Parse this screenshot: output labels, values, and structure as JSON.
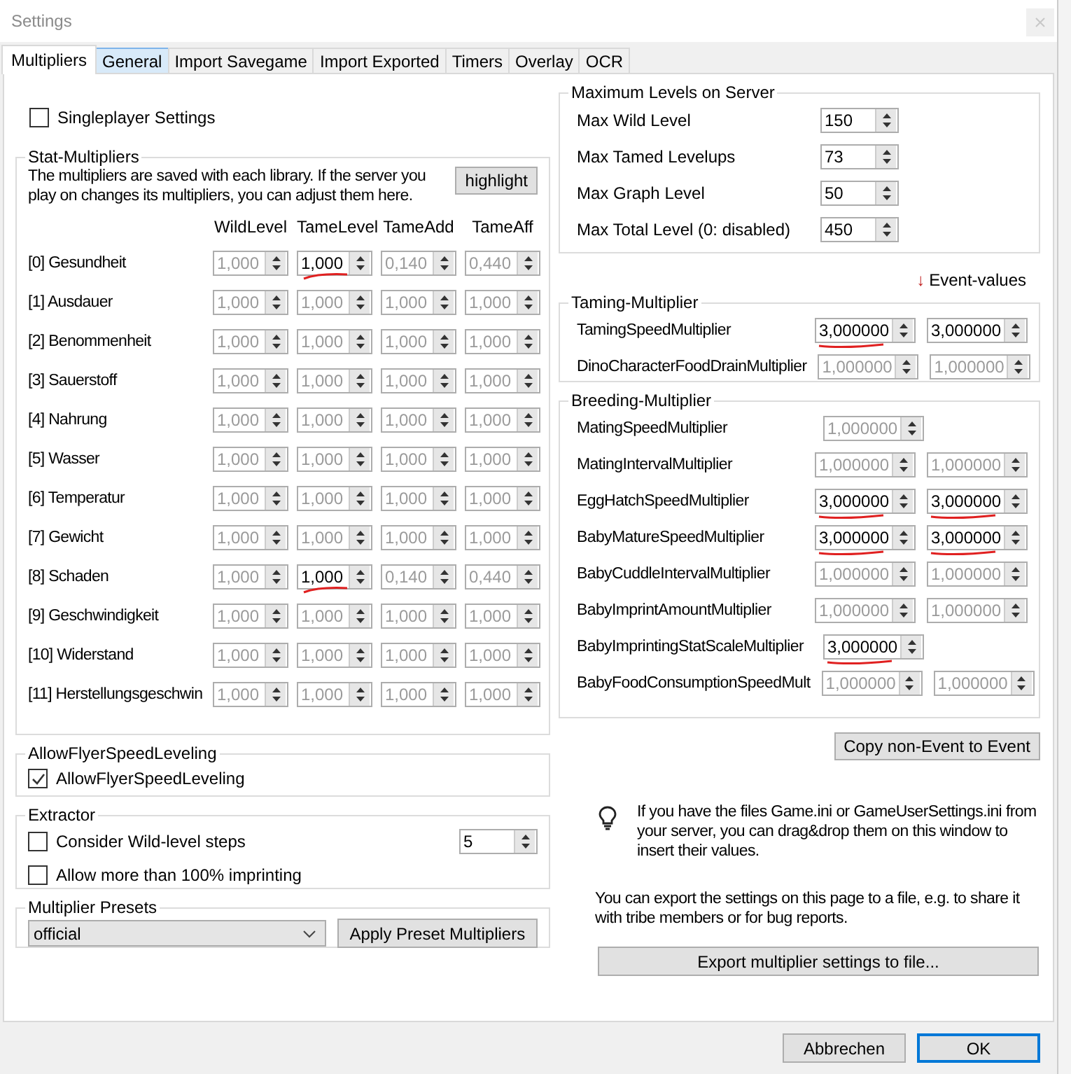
{
  "window": {
    "title": "Settings"
  },
  "tabs": [
    {
      "label": "Multipliers",
      "selected": true,
      "hovered": false
    },
    {
      "label": "General",
      "selected": false,
      "hovered": true
    },
    {
      "label": "Import Savegame",
      "selected": false,
      "hovered": false
    },
    {
      "label": "Import Exported",
      "selected": false,
      "hovered": false
    },
    {
      "label": "Timers",
      "selected": false,
      "hovered": false
    },
    {
      "label": "Overlay",
      "selected": false,
      "hovered": false
    },
    {
      "label": "OCR",
      "selected": false,
      "hovered": false
    }
  ],
  "singleplayer": {
    "label": "Singleplayer Settings",
    "checked": false
  },
  "stat_multipliers": {
    "title": "Stat-Multipliers",
    "note": "The multipliers are saved with each library. If the server you play on changes its multipliers, you can adjust them here.",
    "highlight_button": "highlight",
    "columns": [
      "WildLevel",
      "TameLevel",
      "TameAdd",
      "TameAff"
    ],
    "rows": [
      {
        "label": "[0] Gesundheit",
        "values": [
          {
            "value": "1,000",
            "enabled": false,
            "marked": false
          },
          {
            "value": "1,000",
            "enabled": true,
            "marked": true
          },
          {
            "value": "0,140",
            "enabled": false,
            "marked": false
          },
          {
            "value": "0,440",
            "enabled": false,
            "marked": false
          }
        ]
      },
      {
        "label": "[1] Ausdauer",
        "values": [
          {
            "value": "1,000",
            "enabled": false,
            "marked": false
          },
          {
            "value": "1,000",
            "enabled": false,
            "marked": false
          },
          {
            "value": "1,000",
            "enabled": false,
            "marked": false
          },
          {
            "value": "1,000",
            "enabled": false,
            "marked": false
          }
        ]
      },
      {
        "label": "[2] Benommenheit",
        "values": [
          {
            "value": "1,000",
            "enabled": false,
            "marked": false
          },
          {
            "value": "1,000",
            "enabled": false,
            "marked": false
          },
          {
            "value": "1,000",
            "enabled": false,
            "marked": false
          },
          {
            "value": "1,000",
            "enabled": false,
            "marked": false
          }
        ]
      },
      {
        "label": "[3] Sauerstoff",
        "values": [
          {
            "value": "1,000",
            "enabled": false,
            "marked": false
          },
          {
            "value": "1,000",
            "enabled": false,
            "marked": false
          },
          {
            "value": "1,000",
            "enabled": false,
            "marked": false
          },
          {
            "value": "1,000",
            "enabled": false,
            "marked": false
          }
        ]
      },
      {
        "label": "[4] Nahrung",
        "values": [
          {
            "value": "1,000",
            "enabled": false,
            "marked": false
          },
          {
            "value": "1,000",
            "enabled": false,
            "marked": false
          },
          {
            "value": "1,000",
            "enabled": false,
            "marked": false
          },
          {
            "value": "1,000",
            "enabled": false,
            "marked": false
          }
        ]
      },
      {
        "label": "[5] Wasser",
        "values": [
          {
            "value": "1,000",
            "enabled": false,
            "marked": false
          },
          {
            "value": "1,000",
            "enabled": false,
            "marked": false
          },
          {
            "value": "1,000",
            "enabled": false,
            "marked": false
          },
          {
            "value": "1,000",
            "enabled": false,
            "marked": false
          }
        ]
      },
      {
        "label": "[6] Temperatur",
        "values": [
          {
            "value": "1,000",
            "enabled": false,
            "marked": false
          },
          {
            "value": "1,000",
            "enabled": false,
            "marked": false
          },
          {
            "value": "1,000",
            "enabled": false,
            "marked": false
          },
          {
            "value": "1,000",
            "enabled": false,
            "marked": false
          }
        ]
      },
      {
        "label": "[7] Gewicht",
        "values": [
          {
            "value": "1,000",
            "enabled": false,
            "marked": false
          },
          {
            "value": "1,000",
            "enabled": false,
            "marked": false
          },
          {
            "value": "1,000",
            "enabled": false,
            "marked": false
          },
          {
            "value": "1,000",
            "enabled": false,
            "marked": false
          }
        ]
      },
      {
        "label": "[8] Schaden",
        "values": [
          {
            "value": "1,000",
            "enabled": false,
            "marked": false
          },
          {
            "value": "1,000",
            "enabled": true,
            "marked": true
          },
          {
            "value": "0,140",
            "enabled": false,
            "marked": false
          },
          {
            "value": "0,440",
            "enabled": false,
            "marked": false
          }
        ]
      },
      {
        "label": "[9] Geschwindigkeit",
        "values": [
          {
            "value": "1,000",
            "enabled": false,
            "marked": false
          },
          {
            "value": "1,000",
            "enabled": false,
            "marked": false
          },
          {
            "value": "1,000",
            "enabled": false,
            "marked": false
          },
          {
            "value": "1,000",
            "enabled": false,
            "marked": false
          }
        ]
      },
      {
        "label": "[10] Widerstand",
        "values": [
          {
            "value": "1,000",
            "enabled": false,
            "marked": false
          },
          {
            "value": "1,000",
            "enabled": false,
            "marked": false
          },
          {
            "value": "1,000",
            "enabled": false,
            "marked": false
          },
          {
            "value": "1,000",
            "enabled": false,
            "marked": false
          }
        ]
      },
      {
        "label": "[11] Herstellungsgeschwin",
        "values": [
          {
            "value": "1,000",
            "enabled": false,
            "marked": false
          },
          {
            "value": "1,000",
            "enabled": false,
            "marked": false
          },
          {
            "value": "1,000",
            "enabled": false,
            "marked": false
          },
          {
            "value": "1,000",
            "enabled": false,
            "marked": false
          }
        ]
      }
    ]
  },
  "allow_flyer": {
    "title": "AllowFlyerSpeedLeveling",
    "label": "AllowFlyerSpeedLeveling",
    "checked": true
  },
  "extractor": {
    "title": "Extractor",
    "options": [
      {
        "label": "Consider Wild-level steps",
        "checked": false
      },
      {
        "label": "Allow more than 100% imprinting",
        "checked": false
      }
    ],
    "steps": "5"
  },
  "presets": {
    "title": "Multiplier Presets",
    "selected": "official",
    "button": "Apply Preset Multipliers"
  },
  "max_levels": {
    "title": "Maximum Levels on Server",
    "rows": [
      {
        "label": "Max Wild Level",
        "value": "150"
      },
      {
        "label": "Max Tamed Levelups",
        "value": "73"
      },
      {
        "label": "Max Graph Level",
        "value": "50"
      },
      {
        "label": "Max Total Level (0: disabled)",
        "value": "450"
      }
    ]
  },
  "event_header": {
    "arrow": "↓",
    "label": "Event-values"
  },
  "taming": {
    "title": "Taming-Multiplier",
    "rows": [
      {
        "label": "TamingSpeedMultiplier",
        "values": [
          {
            "value": "3,000000",
            "enabled": true,
            "marked": true
          },
          {
            "value": "3,000000",
            "enabled": true,
            "marked": false
          }
        ]
      },
      {
        "label": "DinoCharacterFoodDrainMultiplier",
        "values": [
          {
            "value": "1,000000",
            "enabled": false,
            "marked": false
          },
          {
            "value": "1,000000",
            "enabled": false,
            "marked": false
          }
        ]
      }
    ]
  },
  "breeding": {
    "title": "Breeding-Multiplier",
    "rows": [
      {
        "label": "MatingSpeedMultiplier",
        "values": [
          {
            "value": "1,000000",
            "enabled": false,
            "marked": false
          }
        ]
      },
      {
        "label": "MatingIntervalMultiplier",
        "values": [
          {
            "value": "1,000000",
            "enabled": false,
            "marked": false
          },
          {
            "value": "1,000000",
            "enabled": false,
            "marked": false
          }
        ]
      },
      {
        "label": "EggHatchSpeedMultiplier",
        "values": [
          {
            "value": "3,000000",
            "enabled": true,
            "marked": true
          },
          {
            "value": "3,000000",
            "enabled": true,
            "marked": true
          }
        ]
      },
      {
        "label": "BabyMatureSpeedMultiplier",
        "values": [
          {
            "value": "3,000000",
            "enabled": true,
            "marked": true
          },
          {
            "value": "3,000000",
            "enabled": true,
            "marked": true
          }
        ]
      },
      {
        "label": "BabyCuddleIntervalMultiplier",
        "values": [
          {
            "value": "1,000000",
            "enabled": false,
            "marked": false
          },
          {
            "value": "1,000000",
            "enabled": false,
            "marked": false
          }
        ]
      },
      {
        "label": "BabyImprintAmountMultiplier",
        "values": [
          {
            "value": "1,000000",
            "enabled": false,
            "marked": false
          },
          {
            "value": "1,000000",
            "enabled": false,
            "marked": false
          }
        ]
      },
      {
        "label": "BabyImprintingStatScaleMultiplier",
        "values": [
          {
            "value": "3,000000",
            "enabled": true,
            "marked": true
          }
        ]
      },
      {
        "label": "BabyFoodConsumptionSpeedMult",
        "values": [
          {
            "value": "1,000000",
            "enabled": false,
            "marked": false
          },
          {
            "value": "1,000000",
            "enabled": false,
            "marked": false
          }
        ]
      }
    ]
  },
  "copy_button": "Copy non-Event to Event",
  "info_text": "If you have the files Game.ini or GameUserSettings.ini from your server, you can drag&drop them on this window to insert their values.",
  "export_text": "You can export the settings on this page to a file, e.g. to share it with tribe members or for bug reports.",
  "export_button": "Export multiplier settings to file...",
  "footer_buttons": [
    {
      "label": "Abbrechen",
      "default": false
    },
    {
      "label": "OK",
      "default": true
    }
  ]
}
